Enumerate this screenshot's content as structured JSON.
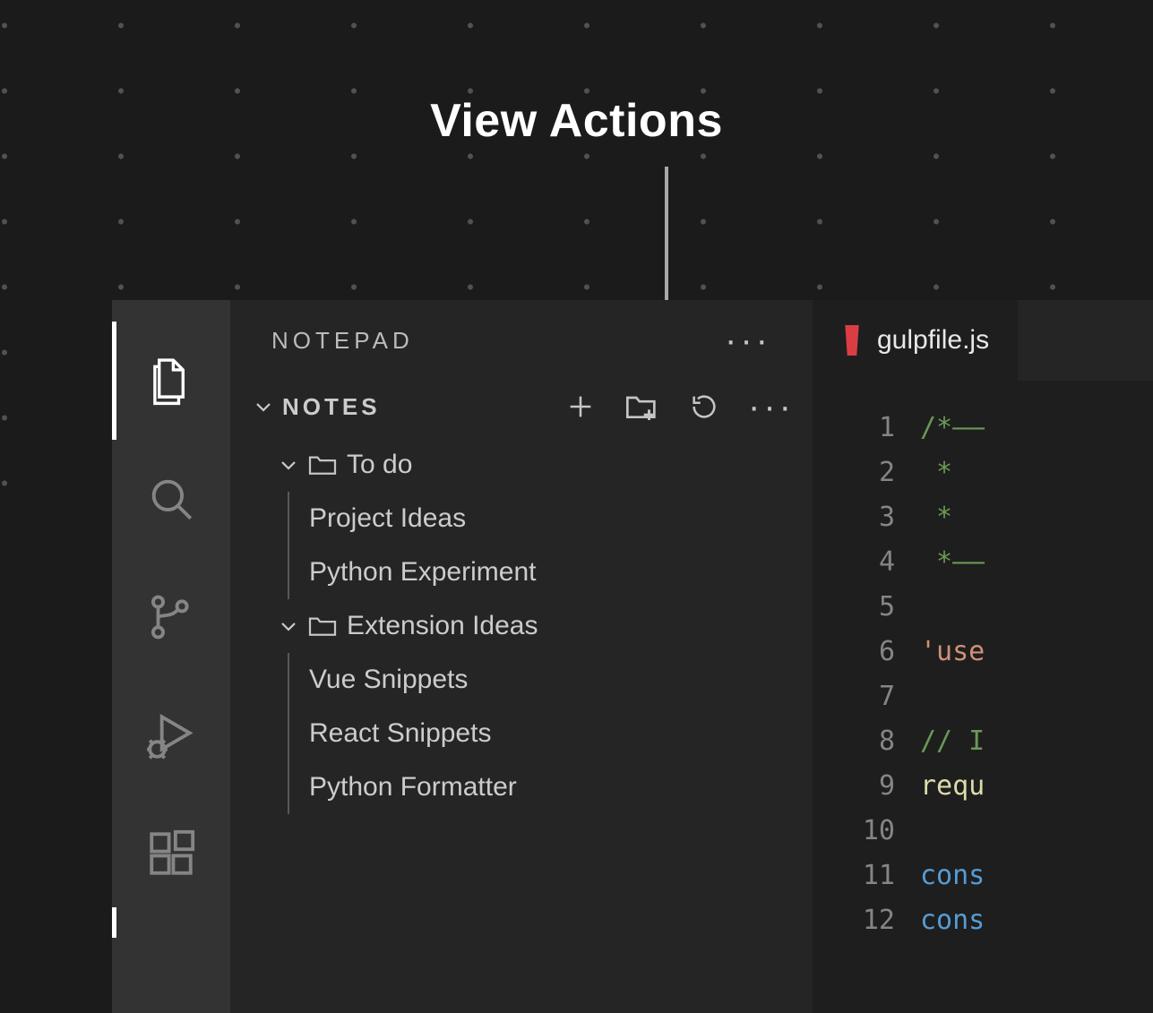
{
  "annotation": {
    "title": "View Actions"
  },
  "sidebar": {
    "title": "NOTEPAD",
    "section": "NOTES",
    "folders": [
      {
        "name": "To do",
        "items": [
          "Project Ideas",
          "Python Experiment"
        ]
      },
      {
        "name": "Extension Ideas",
        "items": [
          "Vue Snippets",
          "React Snippets",
          "Python Formatter"
        ]
      }
    ]
  },
  "editor": {
    "tab": "gulpfile.js",
    "lines": [
      {
        "n": "1",
        "cls": "c-green",
        "t": "/*––"
      },
      {
        "n": "2",
        "cls": "c-green",
        "t": " *  "
      },
      {
        "n": "3",
        "cls": "c-green",
        "t": " *"
      },
      {
        "n": "4",
        "cls": "c-green",
        "t": " *––"
      },
      {
        "n": "5",
        "cls": "",
        "t": ""
      },
      {
        "n": "6",
        "cls": "c-orange",
        "t": "'use"
      },
      {
        "n": "7",
        "cls": "",
        "t": ""
      },
      {
        "n": "8",
        "cls": "c-green",
        "t": "// I"
      },
      {
        "n": "9",
        "cls": "c-yellow",
        "t": "requ"
      },
      {
        "n": "10",
        "cls": "",
        "t": ""
      },
      {
        "n": "11",
        "cls": "c-blue",
        "t": "cons"
      },
      {
        "n": "12",
        "cls": "c-blue",
        "t": "cons"
      }
    ]
  }
}
